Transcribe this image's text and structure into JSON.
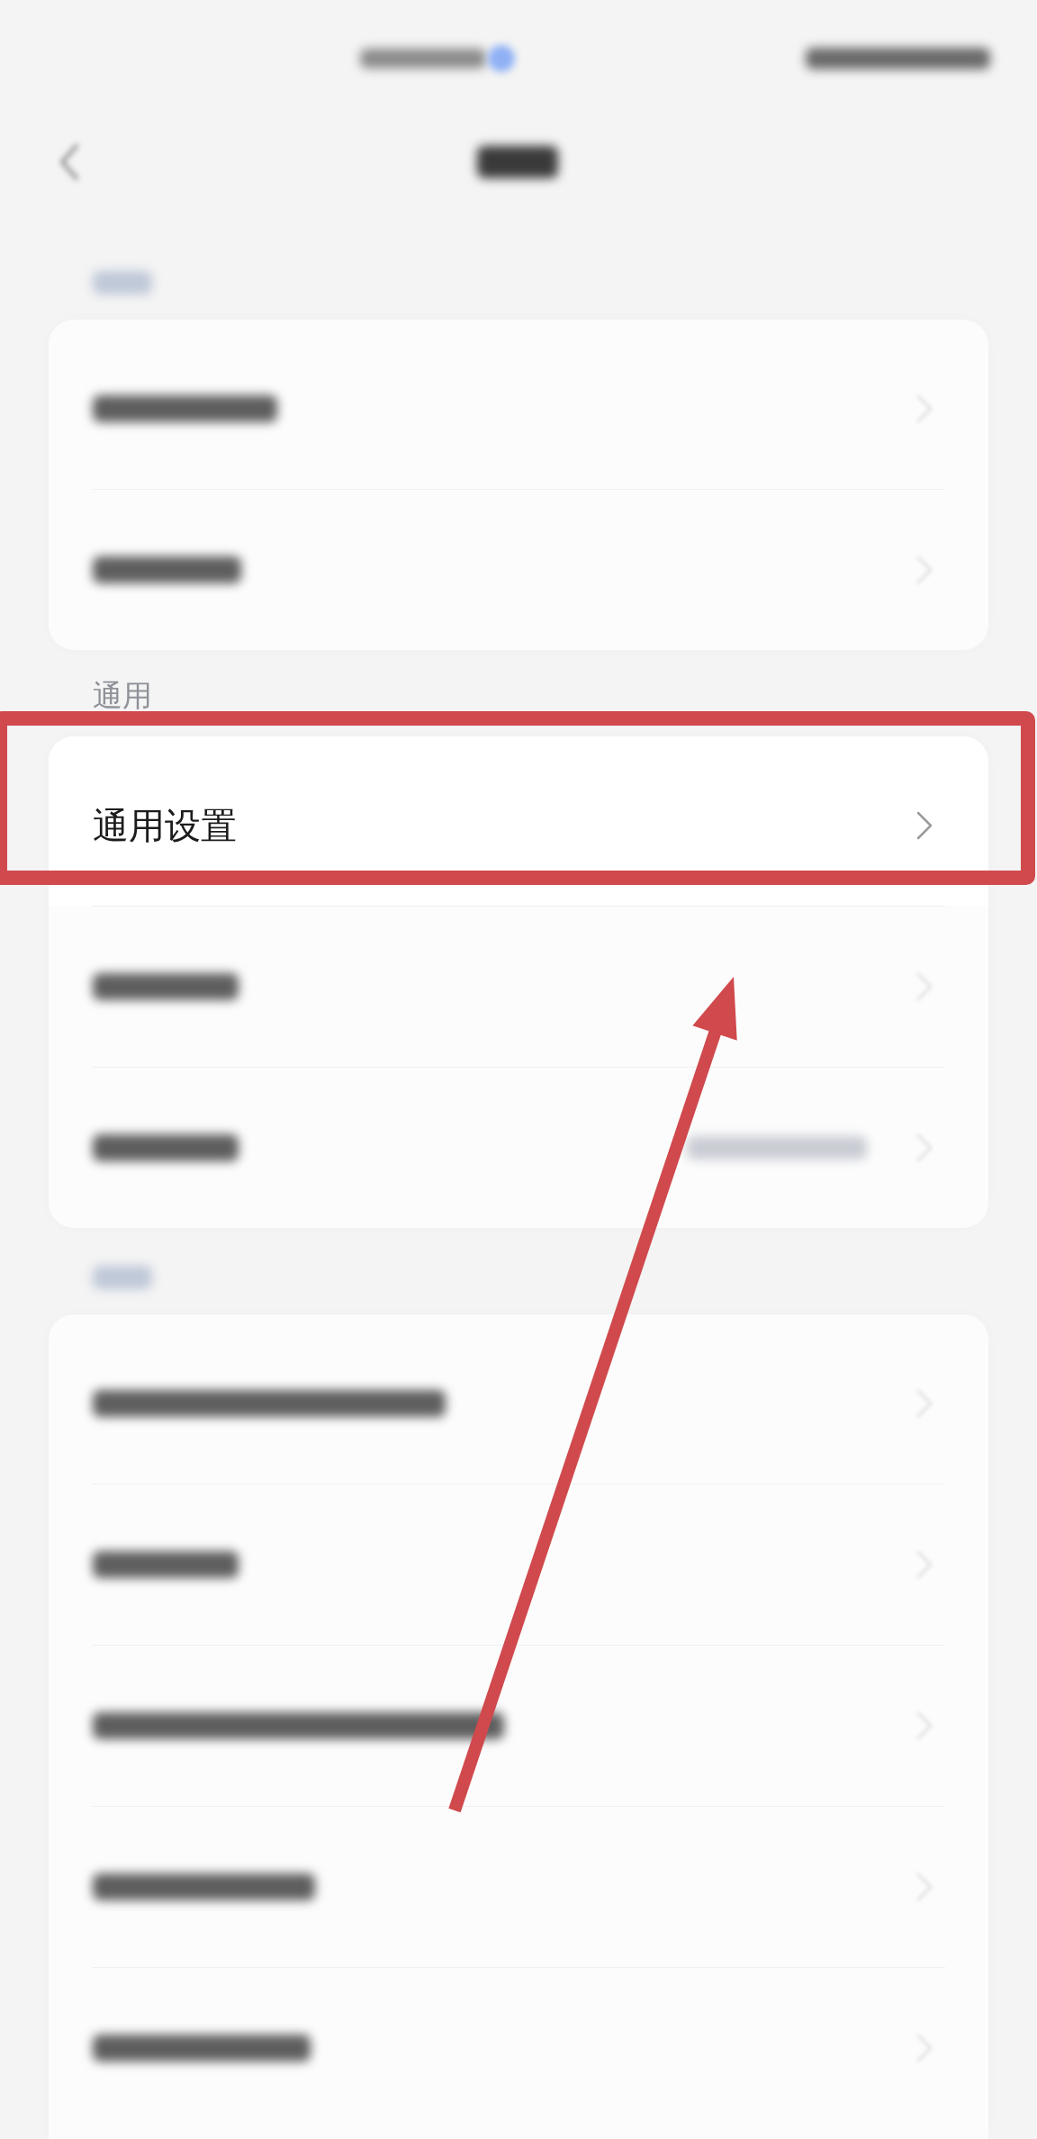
{
  "status_bar": {
    "obscured": true
  },
  "nav_bar": {
    "obscured": true
  },
  "sections": [
    {
      "title_obscured": true,
      "rows": [
        {
          "obscured": true
        },
        {
          "obscured": true
        }
      ]
    },
    {
      "title_obscured": false,
      "title": "通用",
      "rows": [
        {
          "obscured": false,
          "label": "通用设置",
          "framed": true
        },
        {
          "obscured": true
        },
        {
          "obscured": true,
          "value_obscured": true
        }
      ]
    },
    {
      "title_obscured": true,
      "rows": [
        {
          "obscured": true
        },
        {
          "obscured": true
        },
        {
          "obscured": true
        },
        {
          "obscured": true
        },
        {
          "obscured": true
        }
      ]
    }
  ],
  "pointer_arrow": true
}
